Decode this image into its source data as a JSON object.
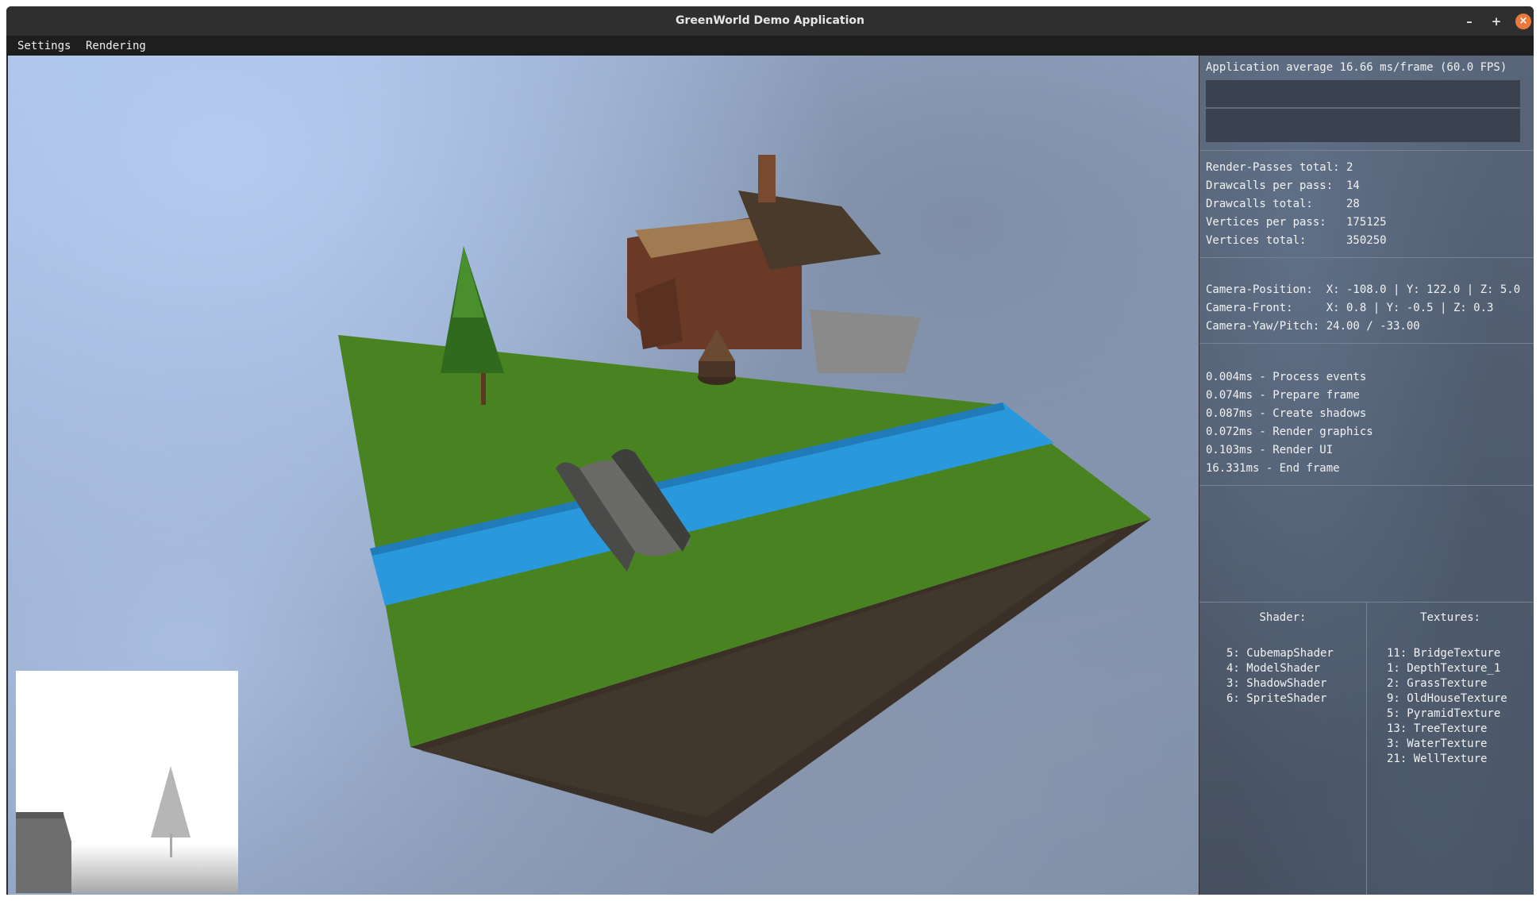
{
  "window": {
    "title": "GreenWorld Demo Application",
    "controls": {
      "minimize": "–",
      "maximize": "+",
      "close": "×"
    }
  },
  "menu": [
    "Settings",
    "Rendering"
  ],
  "stats": {
    "fps_line": "Application average 16.66 ms/frame (60.0 FPS)",
    "render_lines": [
      "Render-Passes total: 2",
      "Drawcalls per pass:  14",
      "Drawcalls total:     28",
      "Vertices per pass:   175125",
      "Vertices total:      350250"
    ],
    "camera_lines": [
      "Camera-Position:  X: -108.0 | Y: 122.0 | Z: 5.0",
      "Camera-Front:     X: 0.8 | Y: -0.5 | Z: 0.3",
      "Camera-Yaw/Pitch: 24.00 / -33.00"
    ],
    "timing_lines": [
      "0.004ms - Process events",
      "0.074ms - Prepare frame",
      "0.087ms - Create shadows",
      "0.072ms - Render graphics",
      "0.103ms - Render UI",
      "16.331ms - End frame"
    ]
  },
  "shaders": {
    "title": "Shader:",
    "items": [
      "5: CubemapShader",
      "4: ModelShader",
      "3: ShadowShader",
      "6: SpriteShader"
    ]
  },
  "textures": {
    "title": "Textures:",
    "items": [
      "11: BridgeTexture",
      "1: DepthTexture_1",
      "2: GrassTexture",
      "9: OldHouseTexture",
      "5: PyramidTexture",
      "13: TreeTexture",
      "3: WaterTexture",
      "21: WellTexture"
    ]
  },
  "colors": {
    "grass": "#4f8a24",
    "water": "#2a98dd",
    "dirt": "#3a3028",
    "close_button": "#e9793a"
  }
}
